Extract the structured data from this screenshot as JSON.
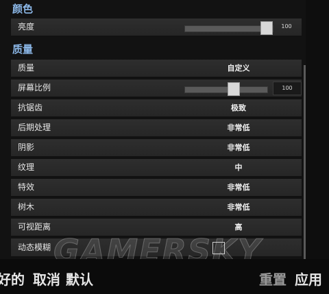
{
  "sections": {
    "color_title": "颜色",
    "quality_title": "质量"
  },
  "brightness": {
    "label": "亮度",
    "value": "100",
    "level": 1.0
  },
  "quality": {
    "label": "质量",
    "value": "自定义"
  },
  "screen_ratio": {
    "label": "屏幕比例",
    "value": "100",
    "level": 0.5
  },
  "antialias": {
    "label": "抗锯齿",
    "value": "极致"
  },
  "postprocess": {
    "label": "后期处理",
    "value": "非常低"
  },
  "shadow": {
    "label": "阴影",
    "value": "非常低"
  },
  "texture": {
    "label": "纹理",
    "value": "中"
  },
  "effects": {
    "label": "特效",
    "value": "非常低"
  },
  "trees": {
    "label": "树木",
    "value": "非常低"
  },
  "view_distance": {
    "label": "可视距离",
    "value": "高"
  },
  "motion_blur": {
    "label": "动态模糊",
    "checked": false
  },
  "watermark": "GAMERSKY",
  "footer": {
    "left_fragment": "好的",
    "cancel": "取消",
    "default": "默认",
    "reset": "重置",
    "apply": "应用"
  }
}
